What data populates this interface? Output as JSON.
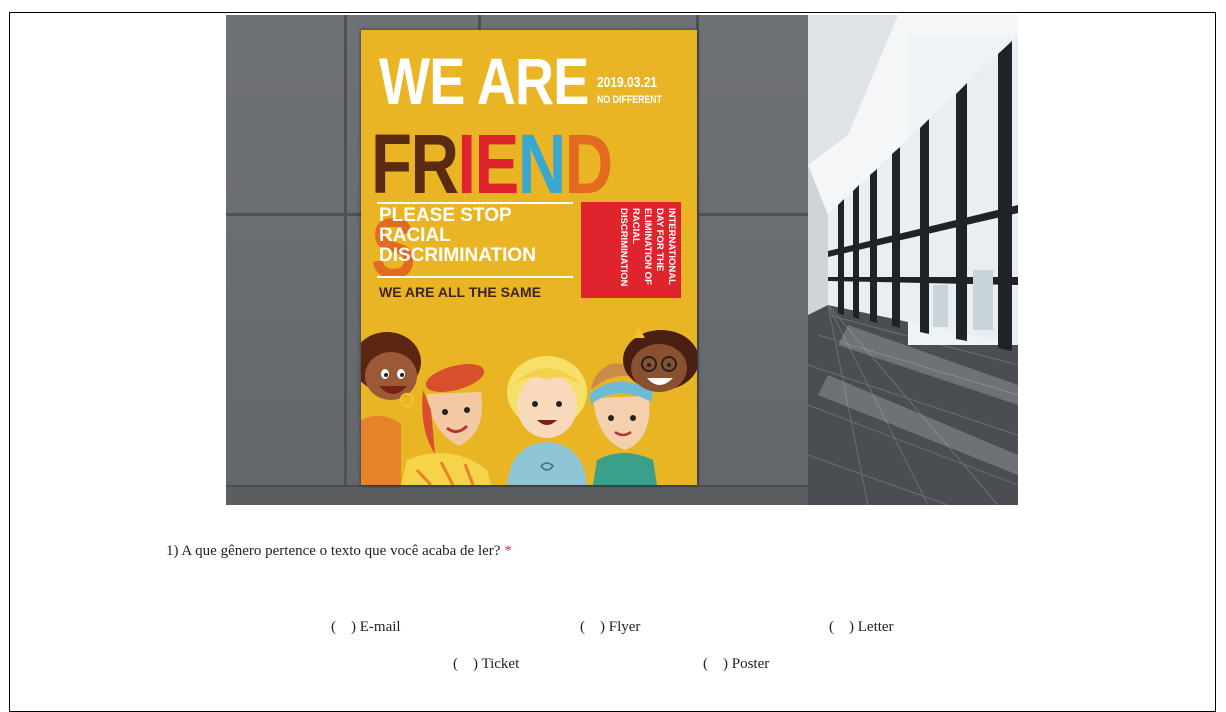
{
  "poster": {
    "headline": "WE ARE",
    "date": "2019.03.21",
    "tagline": "NO DIFFERENT",
    "friends_letters": [
      {
        "char": "F",
        "color": "#5a2a12"
      },
      {
        "char": "R",
        "color": "#5a2a12"
      },
      {
        "char": "I",
        "color": "#e0242e"
      },
      {
        "char": "E",
        "color": "#e0242e"
      },
      {
        "char": "N",
        "color": "#3aa7cf"
      },
      {
        "char": "D",
        "color": "#e36a1f"
      },
      {
        "char": "S",
        "color": "#e36a1f"
      }
    ],
    "message_lines": [
      "PLEASE STOP",
      "RACIAL",
      "DISCRIMINATION"
    ],
    "slogan": "WE ARE ALL THE SAME",
    "red_box_lines": [
      "INTERNATIONAL",
      "DAY FOR THE",
      "ELIMINATION OF",
      "RACIAL",
      "DISCRIMINATION"
    ],
    "background_color": "#e9b524"
  },
  "question": {
    "text": "1) A que gênero pertence o texto que você acaba de ler?",
    "required_mark": "*"
  },
  "options": [
    {
      "paren": "(",
      "label": ") E-mail"
    },
    {
      "paren": "(",
      "label": ") Flyer"
    },
    {
      "paren": "(",
      "label": ") Letter"
    },
    {
      "paren": "(",
      "label": ") Ticket"
    },
    {
      "paren": "(",
      "label": ") Poster"
    }
  ]
}
